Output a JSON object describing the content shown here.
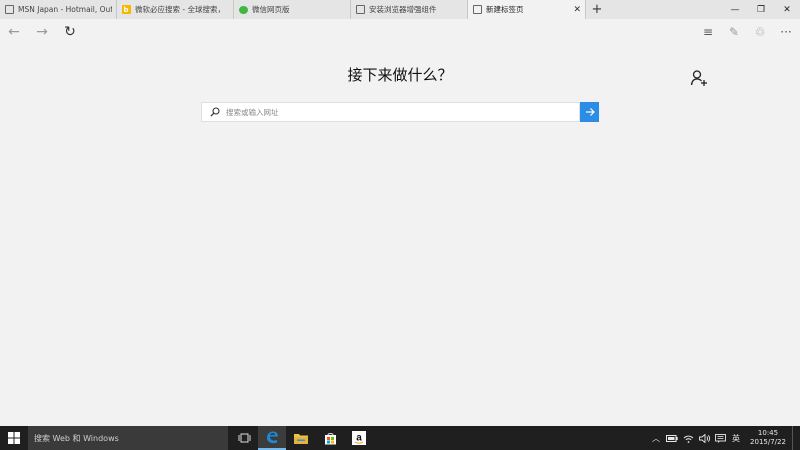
{
  "tabs": [
    {
      "title": "MSN Japan - Hotmail, Outlo",
      "favicon": "page-icon",
      "active": false
    },
    {
      "title": "微软必应搜索 - 全球搜索，",
      "favicon": "bing-icon",
      "active": false
    },
    {
      "title": "微信网页版",
      "favicon": "wechat-icon",
      "active": false
    },
    {
      "title": "安装浏览器增强组件",
      "favicon": "page-icon",
      "active": false
    },
    {
      "title": "新建标签页",
      "favicon": "page-icon",
      "active": true
    }
  ],
  "tab_close_glyph": "✕",
  "new_tab_glyph": "+",
  "window": {
    "minimize": "—",
    "restore": "❐",
    "close": "✕"
  },
  "toolbar": {
    "back": "←",
    "forward": "→",
    "refresh": "↻",
    "hub": "≡",
    "note": "✎",
    "share": "♲",
    "more": "···"
  },
  "main": {
    "heading": "接下来做什么？",
    "search_placeholder": "搜索或输入网址"
  },
  "taskbar": {
    "search_text": "搜索 Web 和 Windows",
    "tray_chevron": "︿",
    "ime": "英",
    "time": "10:45",
    "date": "2015/7/22"
  },
  "colors": {
    "accent": "#2d8ce6",
    "taskbar": "#1f1f1f",
    "edge_blue": "#1e88d8",
    "background": "#f2f2f2"
  }
}
